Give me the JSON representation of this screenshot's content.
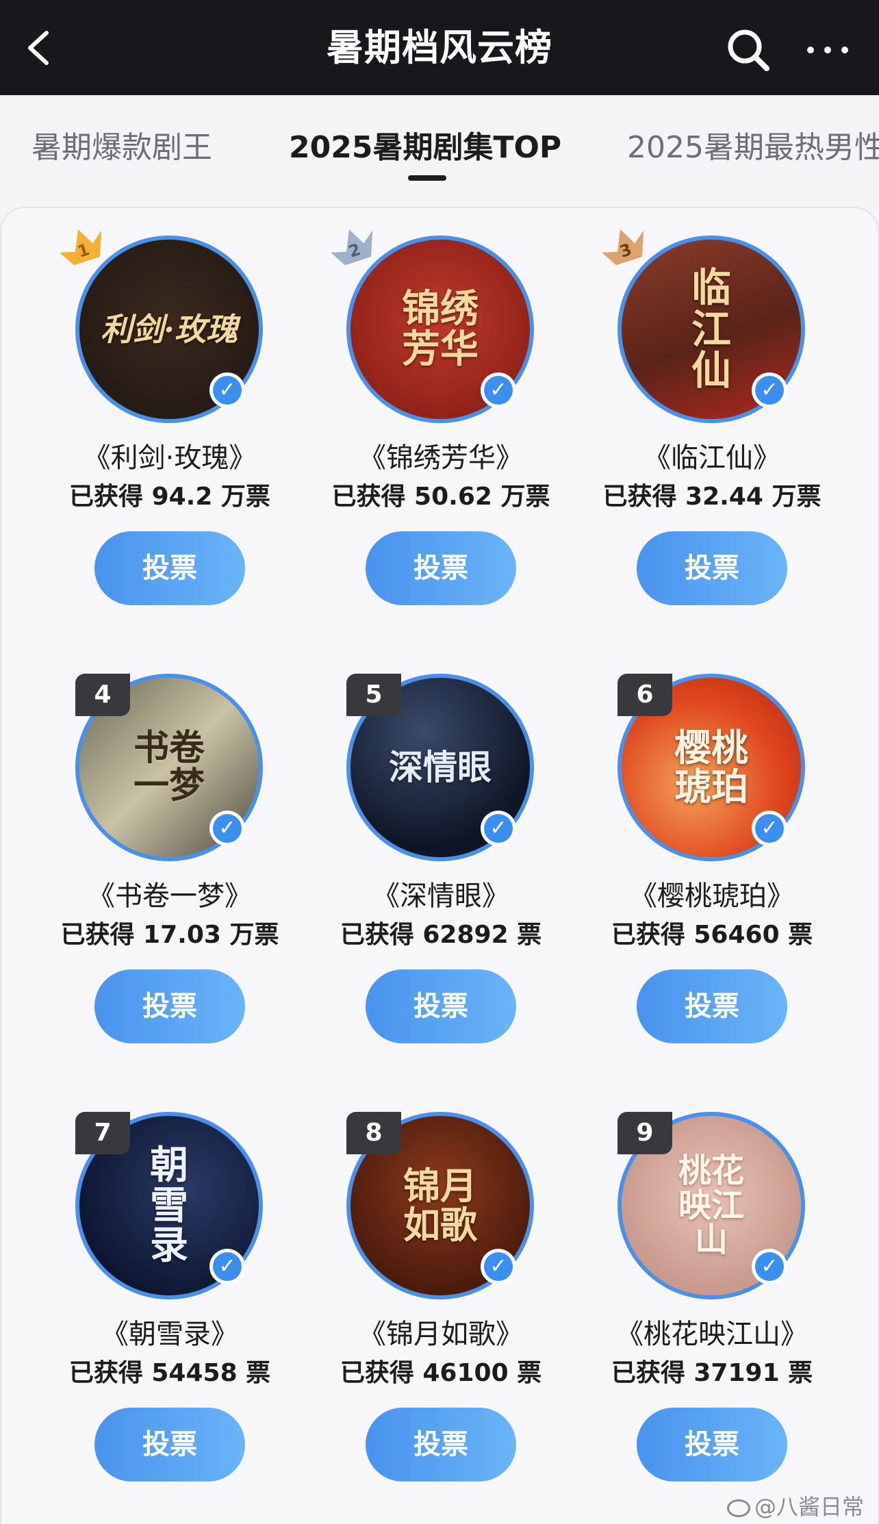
{
  "header": {
    "title": "暑期档风云榜"
  },
  "tabs": [
    {
      "label": "暑期爆款剧王"
    },
    {
      "label": "2025暑期剧集TOP"
    },
    {
      "label": "2025暑期最热男性"
    }
  ],
  "items": [
    {
      "rank": "1",
      "name": "《利剑·玫瑰》",
      "votes": "已获得 94.2 万票",
      "button": "投票",
      "poster_text": "利剑·玫瑰"
    },
    {
      "rank": "2",
      "name": "《锦绣芳华》",
      "votes": "已获得 50.62 万票",
      "button": "投票",
      "poster_text": "锦绣芳华"
    },
    {
      "rank": "3",
      "name": "《临江仙》",
      "votes": "已获得 32.44 万票",
      "button": "投票",
      "poster_text": "临江仙"
    },
    {
      "rank": "4",
      "name": "《书卷一梦》",
      "votes": "已获得 17.03 万票",
      "button": "投票",
      "poster_text": "书卷一梦"
    },
    {
      "rank": "5",
      "name": "《深情眼》",
      "votes": "已获得 62892 票",
      "button": "投票",
      "poster_text": "深情眼"
    },
    {
      "rank": "6",
      "name": "《樱桃琥珀》",
      "votes": "已获得 56460 票",
      "button": "投票",
      "poster_text": "樱桃琥珀"
    },
    {
      "rank": "7",
      "name": "《朝雪录》",
      "votes": "已获得 54458 票",
      "button": "投票",
      "poster_text": "朝雪录"
    },
    {
      "rank": "8",
      "name": "《锦月如歌》",
      "votes": "已获得 46100 票",
      "button": "投票",
      "poster_text": "锦月如歌"
    },
    {
      "rank": "9",
      "name": "《桃花映江山》",
      "votes": "已获得 37191 票",
      "button": "投票",
      "poster_text": "桃花映江山"
    }
  ],
  "watermark": "@八酱日常",
  "colors": {
    "header_bg": "#17181b",
    "vote_button": "#4a93ee",
    "verified_badge": "#3b8ff0",
    "gold": "#f2b134",
    "silver": "#9fb1c9",
    "bronze": "#d9a46f"
  }
}
